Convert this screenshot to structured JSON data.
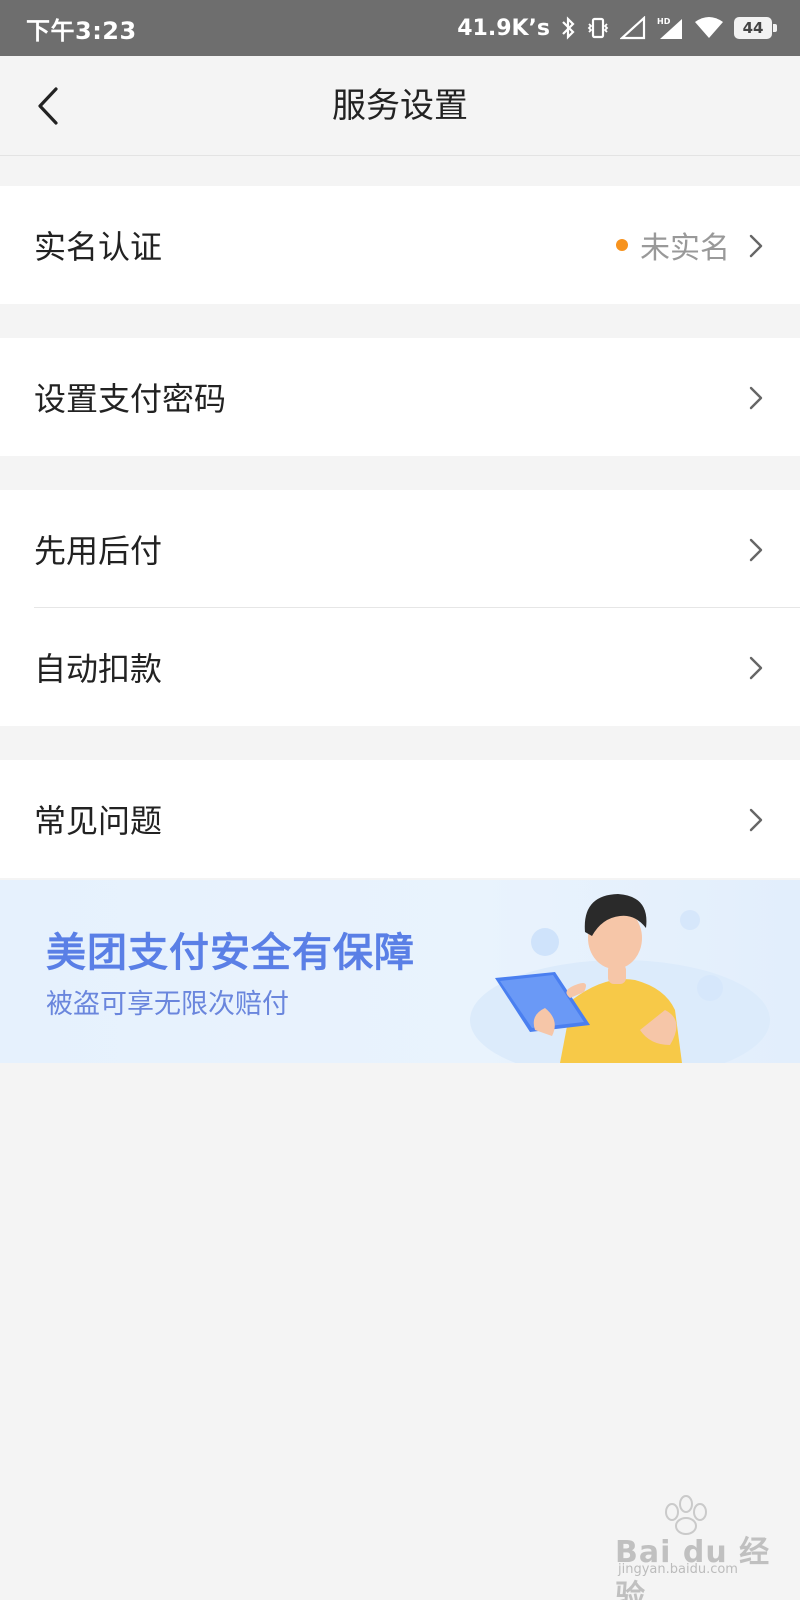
{
  "status_bar": {
    "time": "下午3:23",
    "network_speed": "41.9K’s",
    "battery_level": "44",
    "icons": [
      "bluetooth-icon",
      "vibrate-icon",
      "signal-icon",
      "hd-signal-icon",
      "wifi-icon",
      "battery-icon"
    ]
  },
  "nav": {
    "title": "服务设置",
    "back_icon": "chevron-left-icon"
  },
  "settings": {
    "real_name": {
      "label": "实名认证",
      "status": "未实名",
      "status_color": "#f7931e"
    },
    "pay_password": {
      "label": "设置支付密码"
    },
    "pay_later": {
      "label": "先用后付"
    },
    "auto_deduct": {
      "label": "自动扣款"
    },
    "faq": {
      "label": "常见问题"
    }
  },
  "banner": {
    "title": "美团支付安全有保障",
    "subtitle": "被盗可享无限次赔付",
    "accent_color": "#5a7fe6"
  },
  "watermark": {
    "brand": "Bai du 经验",
    "url": "jingyan.baidu.com"
  },
  "colors": {
    "background": "#f4f4f4",
    "status_bar": "#6e6e6e",
    "orange_dot": "#f7931e"
  }
}
